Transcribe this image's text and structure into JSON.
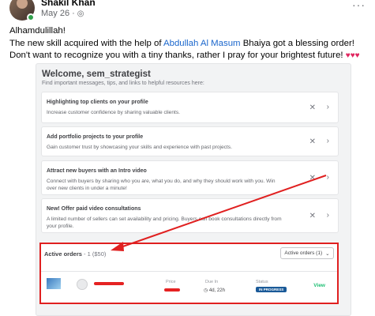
{
  "post": {
    "author": "Shakil Khan",
    "date": "May 26",
    "separator": "·",
    "globe_icon": "globe-icon",
    "more": "···",
    "line1": "Alhamdulillah!",
    "line2_pre": "The new skill acquired with the help of ",
    "line2_link": "Abdullah Al Masum",
    "line2_post": " Bhaiya got a blessing order!",
    "line3": "Don't want to recognize you with a tiny thanks, rather I pray for your brightest future! ",
    "hearts": "♥♥♥"
  },
  "dashboard": {
    "welcome": "Welcome, sem_strategist",
    "welcome_sub": "Find important messages, tips, and links to helpful resources here:",
    "tips": [
      {
        "title": "Highlighting top clients on your profile",
        "desc": "Increase customer confidence by sharing valuable clients.",
        "close": "✕",
        "chevron": "›"
      },
      {
        "title": "Add portfolio projects to your profile",
        "desc": "Gain customer trust by showcasing your skills and experience with past projects.",
        "close": "✕",
        "chevron": "›"
      },
      {
        "title": "Attract new buyers with an Intro video",
        "desc": "Connect with buyers by sharing who you are, what you do, and why they should work with you. Win over new clients in under a minute!",
        "close": "✕",
        "chevron": "›"
      },
      {
        "title": "New! Offer paid video consultations",
        "desc": "A limited number of sellers can set availability and pricing. Buyers can book consultations directly from your profile.",
        "close": "✕",
        "chevron": "›"
      }
    ],
    "active_orders": {
      "title": "Active orders",
      "count": " - 1 ($50)",
      "dropdown": "Active orders (1)",
      "dropdown_chevron": "⌄",
      "columns": {
        "price": "Price",
        "due": "Due In",
        "status": "Status"
      },
      "order": {
        "due_value": "4d, 22h",
        "status": "IN PROGRESS",
        "view": "View"
      }
    }
  },
  "colors": {
    "accent_red": "#e02020",
    "fiverr_green": "#1dbf73",
    "status_blue": "#1a5a98"
  }
}
